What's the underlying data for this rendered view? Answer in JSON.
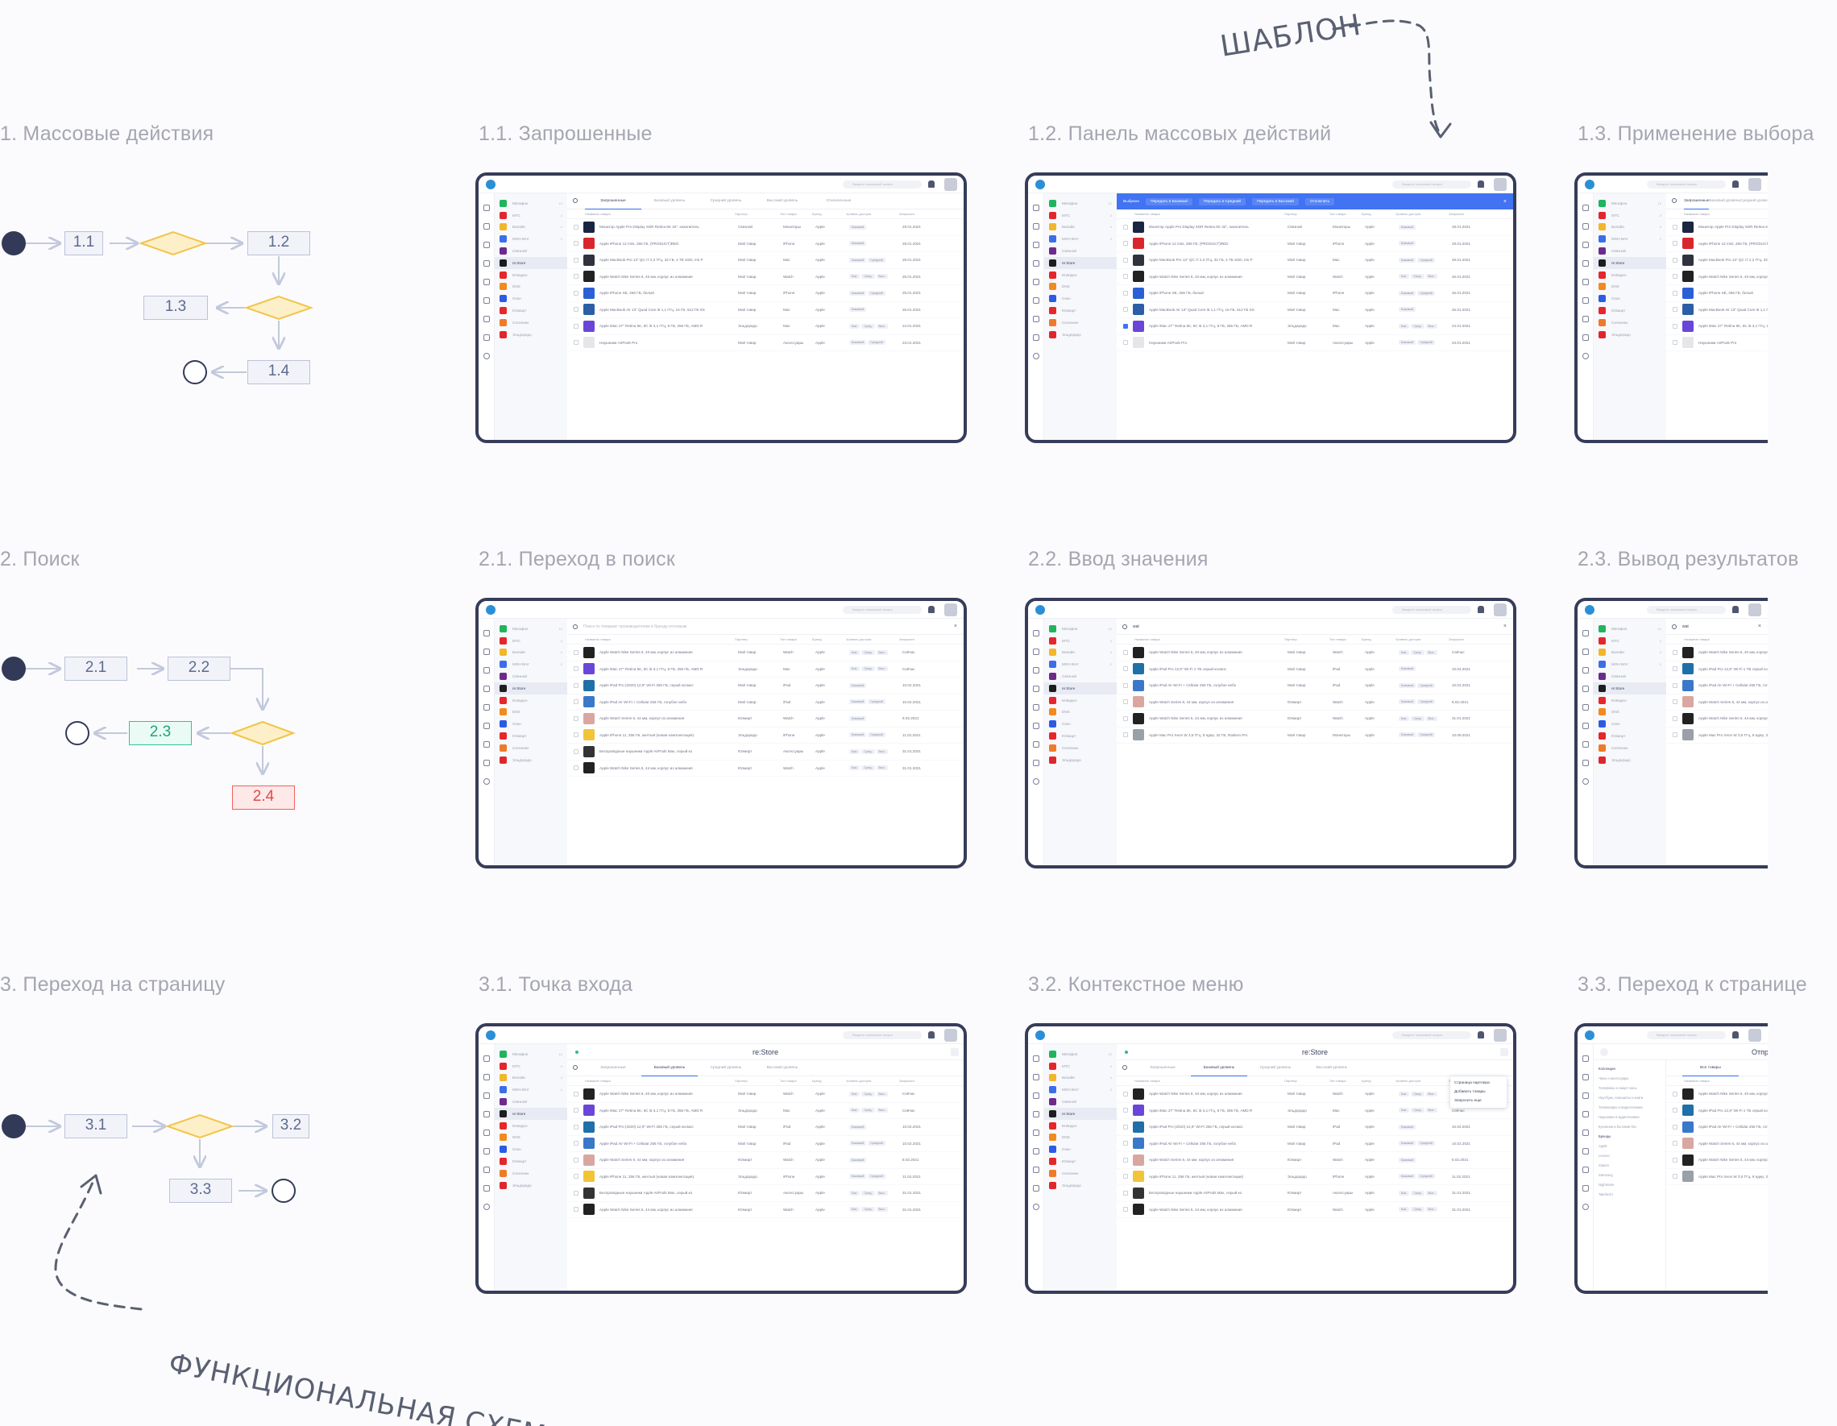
{
  "annotations": {
    "template": "ШАБЛОН",
    "functional_scheme": "ФУНКЦИОНАЛЬНАЯ СХЕМА"
  },
  "sections": [
    {
      "title": "1. Массовые действия",
      "nodes": [
        "1.1",
        "1.2",
        "1.3",
        "1.4"
      ],
      "steps": [
        "1.1. Запрошенные",
        "1.2. Панель массовых действий",
        "1.3. Применение выбора"
      ]
    },
    {
      "title": "2. Поиск",
      "nodes": [
        "2.1",
        "2.2",
        "2.3",
        "2.4"
      ],
      "steps": [
        "2.1. Переход в поиск",
        "2.2. Ввод значения",
        "2.3. Вывод результатов"
      ]
    },
    {
      "title": "3. Переход на страницу",
      "nodes": [
        "3.1",
        "3.2",
        "3.3"
      ],
      "steps": [
        "3.1. Точка входа",
        "3.2. Контекстное меню",
        "3.3. Переход к странице"
      ]
    }
  ],
  "colors": {
    "frame": "#363c59",
    "node_default": "#bcc3d8",
    "node_success": "#2fc49a",
    "node_error": "#f2605f",
    "decision_fill": "#fdefc8",
    "decision_stroke": "#f2c44a",
    "accent_blue": "#4173f2"
  },
  "app": {
    "search_placeholder": "Введите поисковый запрос",
    "partners": [
      {
        "name": "Мегафон",
        "color": "#1fb55c",
        "count": "12"
      },
      {
        "name": "МТС",
        "color": "#e3262b",
        "count": "4"
      },
      {
        "name": "Билайн",
        "color": "#f2b62a",
        "count": "4"
      },
      {
        "name": "МОН ВАУ",
        "color": "#3b6ee8",
        "count": "2"
      },
      {
        "name": "Связной",
        "color": "#6d2a8c",
        "count": ""
      },
      {
        "name": "re:Store",
        "color": "#1d1d1d",
        "count": ""
      },
      {
        "name": "М.Видео",
        "color": "#e5262a",
        "count": ""
      },
      {
        "name": "DNS",
        "color": "#f28a1d",
        "count": ""
      },
      {
        "name": "Озон",
        "color": "#2c5be6",
        "count": ""
      },
      {
        "name": "Юлмарт",
        "color": "#e5262a",
        "count": ""
      },
      {
        "name": "Ситилинк",
        "color": "#f07a28",
        "count": ""
      },
      {
        "name": "Эльдорадо",
        "color": "#e0262c",
        "count": ""
      }
    ],
    "tabs": [
      "Запрошенные",
      "Базовый уровень",
      "Средний уровень",
      "Высокий уровень",
      "Отключенные"
    ],
    "tabs_shop": [
      "Запрошенные",
      "Базовый уровень",
      "Средний уровень",
      "Высокий уровень"
    ],
    "columns": [
      "Название товара",
      "Партнер",
      "Тип товара",
      "Бренд",
      "Уровень доступа",
      "Запрошен"
    ],
    "bulk": {
      "selected": "Выбрано",
      "actions": [
        "Передать в Базовый",
        "Передать в Средний",
        "Передать в Высокий",
        "Отключить"
      ]
    },
    "search_hint": "Поиск по товарам: производителям и бренду итоговым",
    "search_value": "wat",
    "shop_title": "re:Store",
    "context_menu": [
      "Страница партнера",
      "Добавить товары",
      "Запросить еще"
    ],
    "page_title": "Отправка товаров",
    "all_products_tab": "Все товары",
    "filters": [
      "Коллекция",
      "Часы и аксессуары",
      "Телефоны и смарт-часы",
      "Ноутбуки, планшеты и книги",
      "Телевизоры и видеотехника",
      "Наушники и аудиотехника",
      "Кухонная и бытовая без"
    ],
    "brand_filters": [
      "Бренды",
      "Apple",
      "Lenovo",
      "Xiaomi",
      "Samsung",
      "Nightmare",
      "Takefuchi"
    ],
    "rows_requested": [
      {
        "name": "Монитор Apple Pro Display XDR Retina 6K 32\", накопитель",
        "partner": "Связной",
        "type": "Мониторы",
        "brand": "Apple",
        "levels": [
          "Базовый"
        ],
        "date": "29.01.2021",
        "color": "#1b2440"
      },
      {
        "name": "Apple iPhone 12 mini, 256 ГБ, (PRODUCT)RED",
        "partner": "Мой товар",
        "type": "iPhone",
        "brand": "Apple",
        "levels": [
          "Базовый"
        ],
        "date": "29.01.2021",
        "color": "#d9262c"
      },
      {
        "name": "Apple MacBook Pro 13\" QC i7 2,3 ГГц, 32 ГБ, 4 ТБ SSD, Iris P",
        "partner": "Мой товар",
        "type": "Mac",
        "brand": "Apple",
        "levels": [
          "Базовый",
          "Средний"
        ],
        "date": "29.01.2021",
        "color": "#30333d"
      },
      {
        "name": "Apple Watch Nike Series 6, 40 мм, корпус из алюминия",
        "partner": "Мой товар",
        "type": "Watch",
        "brand": "Apple",
        "levels": [
          "Баз.",
          "Сред.",
          "Выс."
        ],
        "date": "26.01.2021",
        "color": "#222"
      },
      {
        "name": "Apple iPhone SE, 256 ГБ, белый",
        "partner": "Мой товар",
        "type": "iPhone",
        "brand": "Apple",
        "levels": [
          "Базовый",
          "Средний"
        ],
        "date": "25.01.2021",
        "color": "#2a5fd6"
      },
      {
        "name": "Apple MacBook Air 13\" Quad Core i5 1,1 ГГц, 16 ГБ, 512 ГБ SS",
        "partner": "Мой товар",
        "type": "Mac",
        "brand": "Apple",
        "levels": [
          "Базовый"
        ],
        "date": "25.01.2021",
        "color": "#2b5ea6"
      },
      {
        "name": "Apple iMac 27\" Retina 5K, 6C i5 3,1 ГГц, 8 ГБ, 256 ГБ, AMD R",
        "partner": "Эльдорадо",
        "type": "Mac",
        "brand": "Apple",
        "levels": [
          "Баз.",
          "Сред.",
          "Выс."
        ],
        "date": "24.01.2021",
        "color": "#6a46d8"
      },
      {
        "name": "Наушники AirPods Pro",
        "partner": "Мой товар",
        "type": "Аксессуары",
        "brand": "Apple",
        "levels": [
          "Базовый",
          "Средний"
        ],
        "date": "23.01.2021",
        "color": "#e6e6e8"
      }
    ],
    "rows_search": [
      {
        "name": "Apple Watch Nike Series 6, 40 мм, корпус из алюминия",
        "partner": "Мой товар",
        "type": "Watch",
        "brand": "Apple",
        "levels": [
          "Баз.",
          "Сред.",
          "Выс."
        ],
        "date": "Сейчас",
        "color": "#222"
      },
      {
        "name": "Apple iMac 27\" Retina 5K, 6C i5 3,1 ГГц, 8 ГБ, 256 ГБ, AMD R",
        "partner": "Эльдорадо",
        "type": "Mac",
        "brand": "Apple",
        "levels": [
          "Баз.",
          "Сред.",
          "Выс."
        ],
        "date": "Сейчас",
        "color": "#6a46d8"
      },
      {
        "name": "Apple iPad Pro (2020) 12,9\" Wi-Fi 256 ГБ, серый космос",
        "partner": "Мой товар",
        "type": "iPad",
        "brand": "Apple",
        "levels": [
          "Базовый"
        ],
        "date": "10.02.2021",
        "color": "#1f6fa8"
      },
      {
        "name": "Apple iPad Air Wi-Fi + Cellular 256 ГБ, голубое небо",
        "partner": "Мой товар",
        "type": "iPad",
        "brand": "Apple",
        "levels": [
          "Базовый",
          "Средний"
        ],
        "date": "10.02.2021",
        "color": "#3a78c9"
      },
      {
        "name": "Apple Watch Series 6, 44 мм, корпус из алюминия",
        "partner": "Юлмарт",
        "type": "Watch",
        "brand": "Apple",
        "levels": [
          "Базовый"
        ],
        "date": "8.02.2021",
        "color": "#d9a7a0"
      },
      {
        "name": "Apple iPhone 11, 256 ГБ, желтый (новая комплектация)",
        "partner": "Эльдорадо",
        "type": "iPhone",
        "brand": "Apple",
        "levels": [
          "Базовый",
          "Средний"
        ],
        "date": "11.02.2021",
        "color": "#f2c438"
      },
      {
        "name": "Беспроводные наушники Apple AirPods Max, серый ко",
        "partner": "Юлмарт",
        "type": "Аксессуары",
        "brand": "Apple",
        "levels": [
          "Баз.",
          "Сред.",
          "Выс."
        ],
        "date": "31.01.2021",
        "color": "#333"
      },
      {
        "name": "Apple Watch Nike Series 5, 44 мм, корпус из алюминия",
        "partner": "Юлмарт",
        "type": "Watch",
        "brand": "Apple",
        "levels": [
          "Баз.",
          "Сред.",
          "Выс."
        ],
        "date": "31.01.2021",
        "color": "#222"
      }
    ],
    "rows_results": [
      {
        "name": "Apple Watch Nike Series 6, 40 мм, корпус из алюминия",
        "partner": "Мой товар",
        "type": "Watch",
        "brand": "Apple",
        "levels": [
          "Баз.",
          "Сред.",
          "Выс."
        ],
        "date": "Сейчас",
        "color": "#222"
      },
      {
        "name": "Apple iPad Pro 12,9\" Wi-Fi 1 ТБ серый космос",
        "partner": "Мой товар",
        "type": "iPad",
        "brand": "Apple",
        "levels": [
          "Базовый"
        ],
        "date": "10.02.2021",
        "color": "#1f6fa8"
      },
      {
        "name": "Apple iPad Air Wi-Fi + Cellular 256 ГБ, голубое небо",
        "partner": "Мой товар",
        "type": "iPad",
        "brand": "Apple",
        "levels": [
          "Базовый",
          "Средний"
        ],
        "date": "10.02.2021",
        "color": "#3a78c9"
      },
      {
        "name": "Apple Watch Series 6, 44 мм, корпус из алюминия",
        "partner": "Юлмарт",
        "type": "Watch",
        "brand": "Apple",
        "levels": [
          "Базовый",
          "Средний"
        ],
        "date": "8.02.2021",
        "color": "#d9a7a0"
      },
      {
        "name": "Apple Watch Nike Series 5, 44 мм, корпус из алюминия",
        "partner": "Юлмарт",
        "type": "Watch",
        "brand": "Apple",
        "levels": [
          "Баз.",
          "Сред.",
          "Выс."
        ],
        "date": "31.01.2021",
        "color": "#222"
      },
      {
        "name": "Apple Mac Pro Xeon W 3,5 ГГц, 8 ядер, 32 ГБ, Radeon Pro",
        "partner": "Мой товар",
        "type": "Мониторы",
        "brand": "Apple",
        "levels": [
          "Базовый",
          "Средний"
        ],
        "date": "10.09.2021",
        "color": "#9aa0a8"
      }
    ]
  }
}
